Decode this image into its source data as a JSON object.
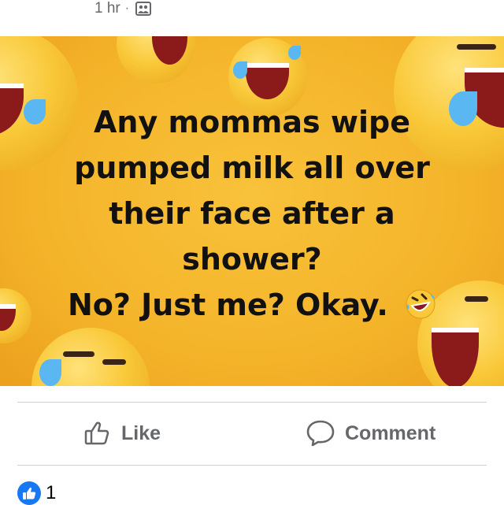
{
  "post": {
    "timestamp": "1 hr",
    "separator": "·",
    "audience_icon": "friends-audience-icon"
  },
  "meme": {
    "lines": [
      "Any mommas wipe",
      "pumped milk all over",
      "their face after a",
      "shower?",
      "No? Just me? Okay."
    ],
    "trailing_emoji": "rolling-on-floor-laughing-emoji",
    "background_color": "#f4b42a",
    "text_color": "#111111"
  },
  "actions": {
    "like_label": "Like",
    "comment_label": "Comment",
    "text_color": "#65676b"
  },
  "reactions": {
    "like_count": "1",
    "badge_color": "#1877f2"
  }
}
